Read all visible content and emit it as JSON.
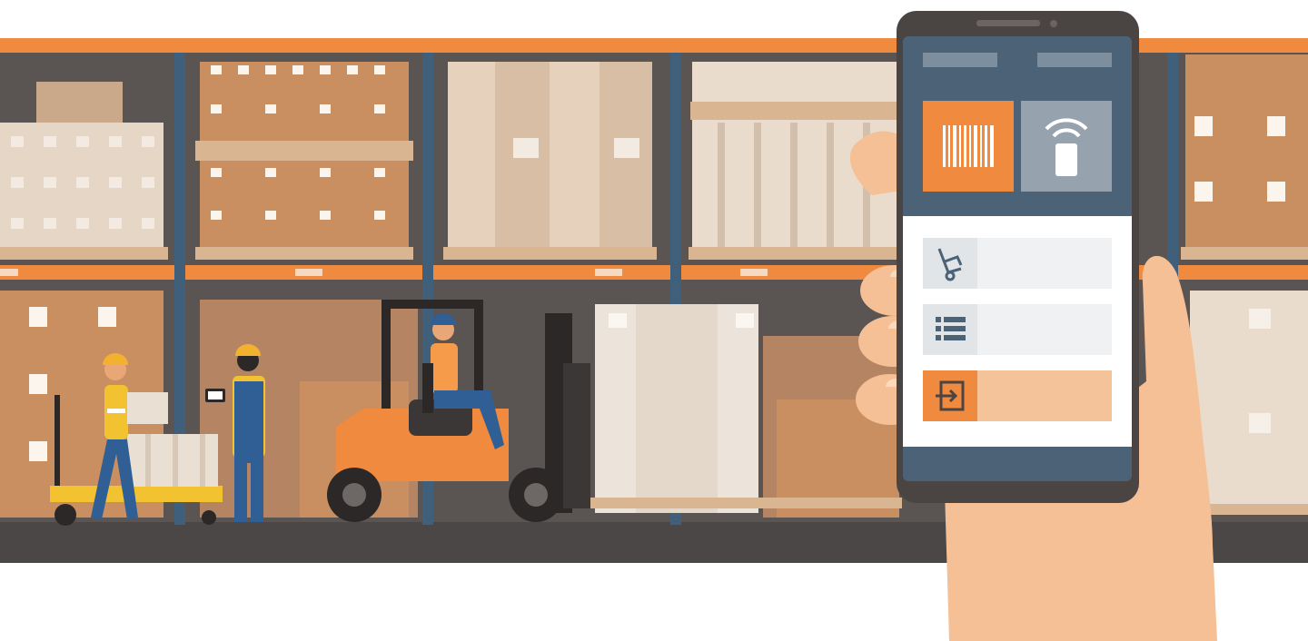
{
  "colors": {
    "background": "#ffffff",
    "shelf_orange": "#ef8a3e",
    "shelf_post": "#3f5f7a",
    "wall": "#5a5553",
    "floor": "#4b4746",
    "box_light": "#e9d8c6",
    "box_mid": "#d9b592",
    "box_dark": "#c98f61",
    "phone_body": "#4a4443",
    "phone_screen_dark": "#4c6277",
    "phone_screen_light": "#ffffff",
    "accent_orange": "#ef8a3e",
    "icon_gray": "#96a2ad",
    "hand_skin": "#f6c096",
    "worker_blue": "#2f5f95",
    "helmet_yellow": "#f2b12e",
    "forklift_orange": "#ef8a3e"
  },
  "phone": {
    "tiles": [
      {
        "icon": "barcode-icon",
        "active": true
      },
      {
        "icon": "rfid-wireless-icon",
        "active": false
      }
    ],
    "menu": [
      {
        "icon": "hand-truck-icon",
        "active": false
      },
      {
        "icon": "list-icon",
        "active": false
      },
      {
        "icon": "inbound-door-icon",
        "active": true
      }
    ]
  },
  "scene": {
    "workers": [
      "worker-carrying-box",
      "worker-with-tablet",
      "forklift-driver"
    ],
    "vehicles": [
      "pallet-jack",
      "forklift"
    ]
  }
}
